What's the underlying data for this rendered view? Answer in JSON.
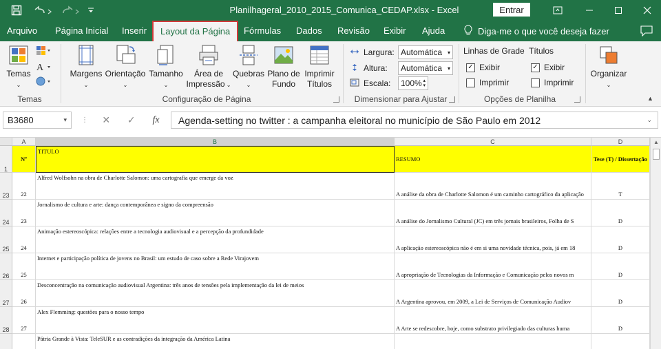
{
  "titlebar": {
    "doc_title": "Planilhageral_2010_2015_Comunica_CEDAP.xlsx  -  Excel",
    "signin_label": "Entrar"
  },
  "tabs": [
    {
      "label": "Arquivo"
    },
    {
      "label": "Página Inicial"
    },
    {
      "label": "Inserir"
    },
    {
      "label": "Layout da Página"
    },
    {
      "label": "Fórmulas"
    },
    {
      "label": "Dados"
    },
    {
      "label": "Revisão"
    },
    {
      "label": "Exibir"
    },
    {
      "label": "Ajuda"
    }
  ],
  "tell_me": "Diga-me o que você deseja fazer",
  "ribbon": {
    "themes": {
      "button": "Temas",
      "group": "Temas"
    },
    "page_setup": {
      "margins": "Margens",
      "orientation": "Orientação",
      "size": "Tamanho",
      "print_area_1": "Área de",
      "print_area_2": "Impressão",
      "breaks": "Quebras",
      "background_1": "Plano de",
      "background_2": "Fundo",
      "print_titles_1": "Imprimir",
      "print_titles_2": "Títulos",
      "group": "Configuração de Página"
    },
    "scale_to_fit": {
      "width_label": "Largura:",
      "width_value": "Automática",
      "height_label": "Altura:",
      "height_value": "Automática",
      "scale_label": "Escala:",
      "scale_value": "100%",
      "group": "Dimensionar para Ajustar"
    },
    "sheet_options": {
      "gridlines": "Linhas de Grade",
      "headings": "Títulos",
      "view": "Exibir",
      "print": "Imprimir",
      "group": "Opções de Planilha"
    },
    "arrange": {
      "button": "Organizar"
    }
  },
  "formula_bar": {
    "name_box": "B3680",
    "content": "Agenda-setting no twitter : a campanha eleitoral no município de São Paulo em 2012"
  },
  "grid": {
    "columns": [
      "A",
      "B",
      "C",
      "D"
    ],
    "header_row": {
      "row_num": "1",
      "a": "Nº",
      "b": "TITULO",
      "c": "RESUMO",
      "d": "Tese (T) / Dissertação"
    },
    "rows": [
      {
        "row_num": "23",
        "a": "22",
        "b": "Alfred Wolfsohn na obra de Charlotte Salomon: uma cartografia que emerge da voz",
        "c": "A análise da obra de Charlotte Salomon é um caminho cartográfico da aplicação",
        "d": "T"
      },
      {
        "row_num": "24",
        "a": "23",
        "b": "Jornalismo de cultura e arte: dança contemporânea e signo da compreensão",
        "c": "A análise do Jornalismo Cultural (JC) em três jornais brasileiros, Folha de S",
        "d": "D"
      },
      {
        "row_num": "25",
        "a": "24",
        "b": "Animação estereoscópica: relações entre a tecnologia audiovisual e a percepção da profundidade",
        "c": "A aplicação estereoscópica não é em si uma novidade técnica, pois, já em 18",
        "d": "D"
      },
      {
        "row_num": "26",
        "a": "25",
        "b": "Internet e participação política de jovens no Brasil: um estudo de caso sobre a Rede Virajovem",
        "c": "A apropriação de Tecnologias da Informação e Comunicação pelos novos m",
        "d": "D"
      },
      {
        "row_num": "27",
        "a": "26",
        "b": "Desconcentração na comunicação audiovisual Argentina: três anos de tensões pela implementação da lei de meios",
        "c": "A Argentina aprovou, em 2009, a Lei de Serviços de Comunicação Audiov",
        "d": "D"
      },
      {
        "row_num": "28",
        "a": "27",
        "b": "Alex Flemming: questões para o nosso tempo",
        "c": "A Arte se redescobre, hoje, como substrato privilegiado das culturas huma",
        "d": "D"
      },
      {
        "row_num": "",
        "a": "",
        "b": "Pátria Grande à Vista: TeleSUR e as contradições da integração da América Latina",
        "c": "",
        "d": ""
      }
    ]
  },
  "colors": {
    "excel_green": "#217346",
    "header_fill": "#ffff00",
    "active_tab_outline": "#d03a3a"
  }
}
